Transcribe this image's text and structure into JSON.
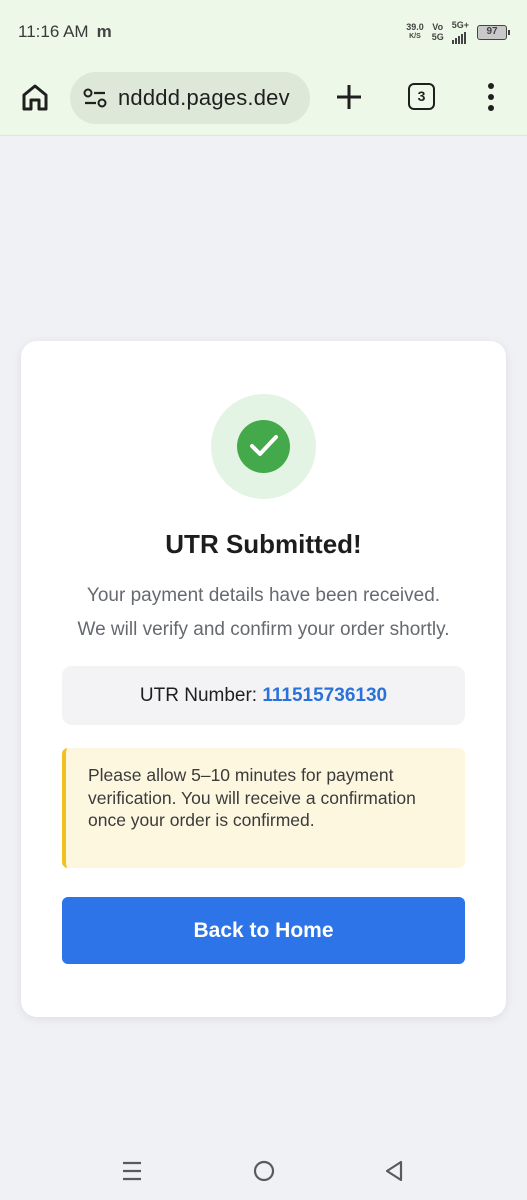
{
  "status_bar": {
    "time": "11:16 AM",
    "app_glyph": "m",
    "net_speed_value": "39.0",
    "net_speed_unit": "K/S",
    "volte_top": "Vo",
    "volte_bottom": "5G",
    "network_type": "5G+",
    "battery": "97"
  },
  "browser": {
    "url": "ndddd.pages.dev",
    "tab_count": "3",
    "icons": {
      "home": "home-icon",
      "site_settings": "site-settings-icon",
      "new_tab": "plus-icon",
      "menu": "more-vert-icon"
    }
  },
  "card": {
    "title": "UTR Submitted!",
    "description_line1": "Your payment details have been received.",
    "description_line2": "We will verify and confirm your order shortly.",
    "utr_label": "UTR Number: ",
    "utr_value": "111515736130",
    "notice": "Please allow 5–10 minutes for payment verification. You will receive a confirmation once your order is confirmed.",
    "button_label": "Back to Home"
  },
  "colors": {
    "success_green": "#43a94a",
    "success_bg": "#e3f3e4",
    "accent_blue": "#2d74e8",
    "link_blue": "#2a72d8",
    "notice_bg": "#fdf7e0",
    "notice_border": "#f2c021",
    "browser_chrome": "#eef8e9"
  }
}
